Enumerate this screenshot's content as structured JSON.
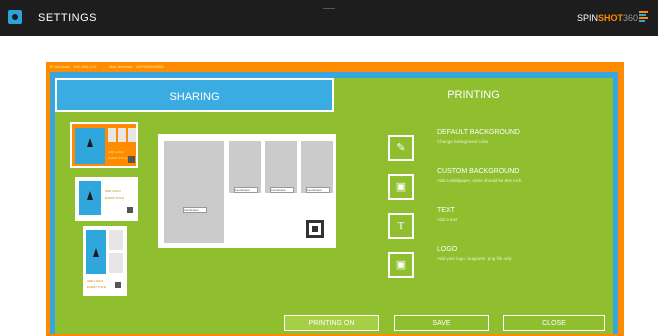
{
  "header": {
    "title": "SETTINGS",
    "brand_part1": "SPIN",
    "brand_part2": "SHOT",
    "brand_part3": "360",
    "gear_icon": "gear-icon"
  },
  "network": {
    "ip_label": "IP Address:",
    "ip_value": "192.168.1.27",
    "mac_label": "Mac Address:",
    "mac_value": "24F094E64058"
  },
  "tabs": {
    "sharing": "SHARING",
    "printing": "PRINTING"
  },
  "thumbs": {
    "t1_line1": "ADD LOGO",
    "t1_line2": "EVENT TITLE",
    "t2_line1": "ADD LOGO",
    "t2_line2": "EVENT TITLE",
    "t3_line1": "ADD LOGO",
    "t3_line2": "EVENT TITLE"
  },
  "preview": {
    "select1": "Landscape",
    "select2": "Landscape",
    "select3": "Landscape",
    "select4": "Landscape"
  },
  "options": [
    {
      "title": "DEFAULT BACKGROUND",
      "subtitle": "Change background color",
      "icon": "paint-bucket-icon"
    },
    {
      "title": "CUSTOM BACKGROUND",
      "subtitle": "Add a Wallpaper, sizes should be 8x6 inch",
      "icon": "image-icon"
    },
    {
      "title": "TEXT",
      "subtitle": "Add a text",
      "icon": "text-icon"
    },
    {
      "title": "LOGO",
      "subtitle": "Add your logo. Supports .png file only",
      "icon": "logo-image-icon"
    }
  ],
  "buttons": {
    "printing_on": "PRINTING ON",
    "save": "SAVE",
    "close": "CLOSE"
  },
  "colors": {
    "topbar": "#1d1d1d",
    "orange": "#ff8c00",
    "blue": "#37a6e0",
    "green": "#8fbe2e"
  }
}
